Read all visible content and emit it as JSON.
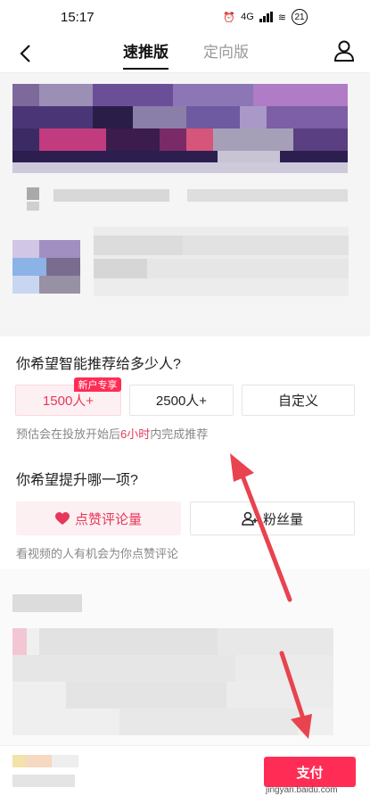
{
  "status_bar": {
    "time": "15:17",
    "network": "4G",
    "battery": "21"
  },
  "header": {
    "tabs": [
      "速推版",
      "定向版"
    ]
  },
  "audience": {
    "question": "你希望智能推荐给多少人?",
    "options": [
      "1500人+",
      "2500人+",
      "自定义"
    ],
    "badge": "新户专享",
    "hint_prefix": "预估会在投放开始后",
    "hint_highlight": "6小时",
    "hint_suffix": "内完成推荐"
  },
  "goal": {
    "question": "你希望提升哪一项?",
    "options": [
      "点赞评论量",
      "粉丝量"
    ],
    "hint": "看视频的人有机会为你点赞评论"
  },
  "footer": {
    "cta_label": "支付",
    "watermark": "jingyan.baidu.com"
  },
  "colors": {
    "accent": "#ff2d55",
    "selected_bg": "#fdf0f2",
    "arrow": "#e8434f"
  }
}
